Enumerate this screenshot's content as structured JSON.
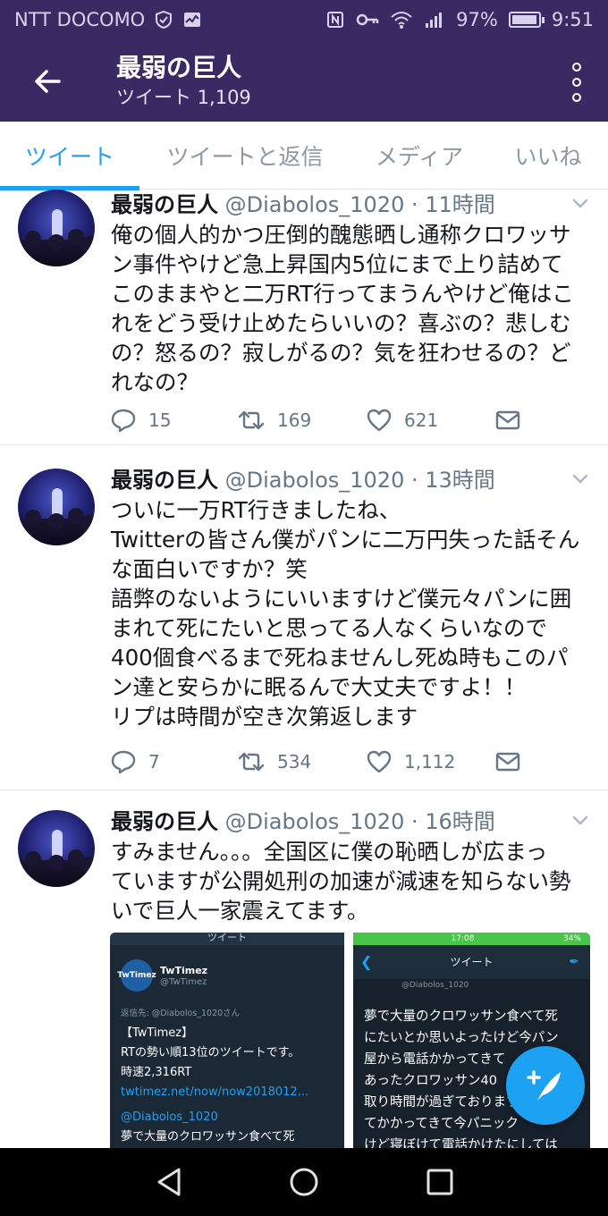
{
  "status_bar": {
    "carrier": "NTT DOCOMO",
    "battery": "97%",
    "battery_level": 0.97,
    "time": "9:51"
  },
  "header": {
    "title": "最弱の巨人",
    "subtitle": "ツイート 1,109"
  },
  "tabs": [
    {
      "label": "ツイート",
      "active": true
    },
    {
      "label": "ツイートと返信",
      "active": false
    },
    {
      "label": "メディア",
      "active": false
    },
    {
      "label": "いいね",
      "active": false
    }
  ],
  "tweets": [
    {
      "name": "最弱の巨人",
      "meta": " @Diabolos_1020 · 11時間",
      "lines": [
        "俺の個人的かつ圧倒的醜態晒し通称クロワッサ",
        "ン事件やけど急上昇国内5位にまで上り詰めて",
        "このままやと二万RT行ってまうんやけど俺はこ",
        "れをどう受け止めたらいいの？喜ぶの？悲しむ",
        "の？怒るの？寂しがるの？気を狂わせるの？ど",
        "れなの？"
      ],
      "replies": "15",
      "retweets": "169",
      "likes": "621"
    },
    {
      "name": "最弱の巨人",
      "meta": " @Diabolos_1020 · 13時間",
      "lines": [
        "ついに一万RT行きましたね、",
        "Twitterの皆さん僕がパンに二万円失った話そん",
        "な面白いですか？笑",
        "語弊のないようにいいますけど僕元々パンに囲",
        "まれて死にたいと思ってる人なくらいなので",
        "400個食べるまで死ねませんし死ぬ時もこのパ",
        "ン達と安らかに眠るんで大丈夫ですよ！！",
        "リプは時間が空き次第返します"
      ],
      "replies": "7",
      "retweets": "534",
      "likes": "1,112"
    },
    {
      "name": "最弱の巨人",
      "meta": " @Diabolos_1020 · 16時間",
      "lines": [
        "すみません。。。全国区に僕の恥晒しが広まっ",
        "ていますが公開処刑の加速が減速を知らない勢",
        "いで巨人一家震えてます。"
      ]
    }
  ],
  "media": {
    "left": {
      "bar_title": "ツイート",
      "account_name": "TwTimez",
      "account_handle": "@TwTimez",
      "logo_text": "TwTimez",
      "reply_to": "返信先: @Diabolos_1020さん",
      "lines": [
        "【TwTimez】",
        "RTの勢い順13位のツイートです。",
        "時速2,316RT"
      ],
      "link": "twtimez.net/now/now2018012...",
      "mention": "@Diabolos_1020",
      "quote": "夢で大量のクロワッサン食べて死"
    },
    "right": {
      "time": "17:08",
      "battery": "34%",
      "nav_title": "ツイート",
      "prev_handle": "@Diabolos_1020",
      "lines": [
        "夢で大量のクロワッサン食べて死",
        "にたいとか思いよったけど今パン",
        "屋から電話かかってきて",
        "あったクロワッサン40",
        "取り時間が過ぎております",
        "てかかってきて今パニック",
        "けど寝ぼけて電話かけたにしては"
      ]
    }
  },
  "colors": {
    "header_bg": "#3a2a63",
    "accent": "#1da1f2",
    "text": "#14171a",
    "muted": "#657786"
  }
}
